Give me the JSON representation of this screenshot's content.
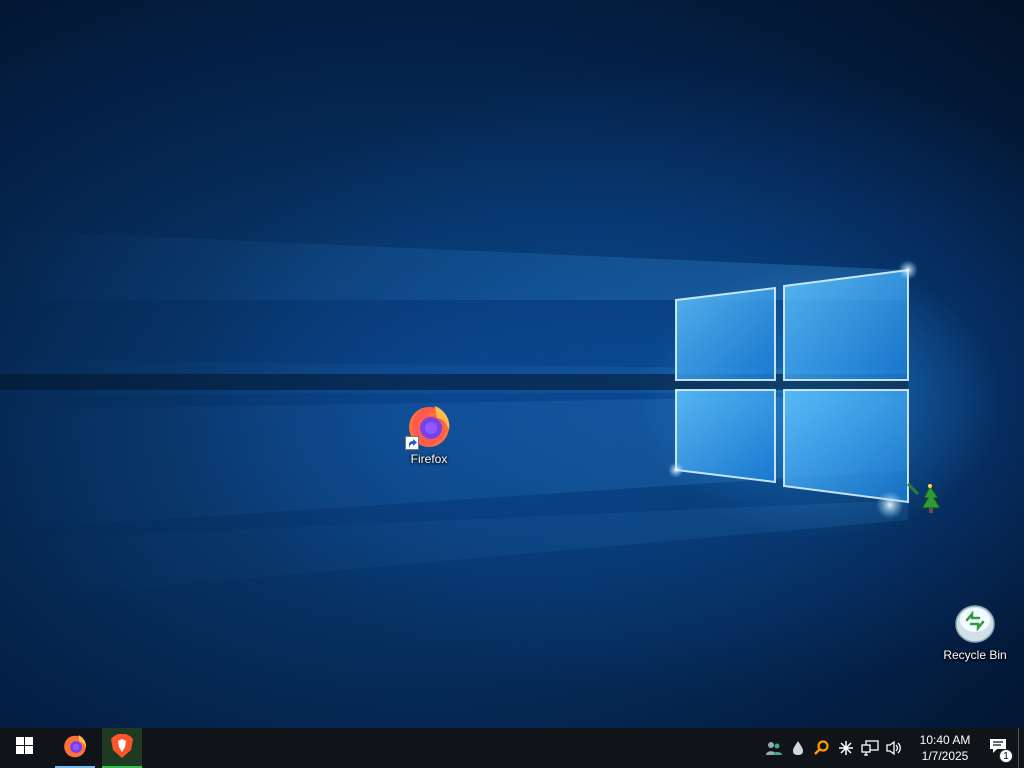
{
  "desktop": {
    "icons": [
      {
        "label": "Firefox",
        "icon": "firefox-icon"
      },
      {
        "label": "Recycle Bin",
        "icon": "recycle-bin-icon"
      }
    ]
  },
  "taskbar": {
    "start_icon": "windows-logo-icon",
    "apps": [
      {
        "icon": "firefox-icon",
        "active": false
      },
      {
        "icon": "brave-icon",
        "active": true
      }
    ],
    "tray": {
      "icons": [
        "people-icon",
        "droplet-icon",
        "search-magnifier-icon",
        "asterisk-icon",
        "network-icon",
        "volume-icon"
      ],
      "time": "10:40 AM",
      "date": "1/7/2025",
      "notification_count": "1"
    }
  },
  "colors": {
    "taskbar": "#101418",
    "firefox_active_underline": "#76b9ed",
    "brave_active_underline": "#33c24a"
  }
}
